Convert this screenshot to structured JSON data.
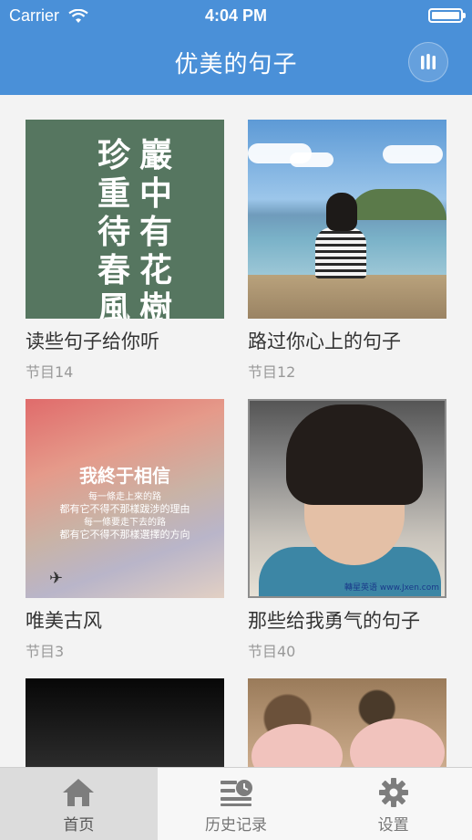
{
  "status_bar": {
    "carrier": "Carrier",
    "time": "4:04 PM"
  },
  "nav": {
    "title": "优美的句子",
    "menu_icon": "bars-icon"
  },
  "cards": [
    {
      "title": "读些句子给你听",
      "count": "节目14",
      "image_text": {
        "col_right": "巖中有花樹",
        "col_left": "珍重待春風"
      }
    },
    {
      "title": "路过你心上的句子",
      "count": "节目12"
    },
    {
      "title": "唯美古风",
      "count": "节目3",
      "image_text": {
        "heading": "我終于相信",
        "lines": [
          "每一條走上來的路",
          "都有它不得不那樣跋涉的理由",
          "每一條要走下去的路",
          "都有它不得不那樣選擇的方向"
        ]
      }
    },
    {
      "title": "那些给我勇气的句子",
      "count": "节目40",
      "image_text": {
        "watermark": "轉星英语 www.Jxen.com"
      }
    },
    {
      "title": "",
      "count": ""
    },
    {
      "title": "",
      "count": ""
    }
  ],
  "tabs": [
    {
      "label": "首页",
      "icon": "home-icon",
      "active": true
    },
    {
      "label": "历史记录",
      "icon": "history-icon",
      "active": false
    },
    {
      "label": "设置",
      "icon": "gear-icon",
      "active": false
    }
  ],
  "colors": {
    "nav_bg": "#4a90d8",
    "tab_active_bg": "#dcdcdc"
  }
}
